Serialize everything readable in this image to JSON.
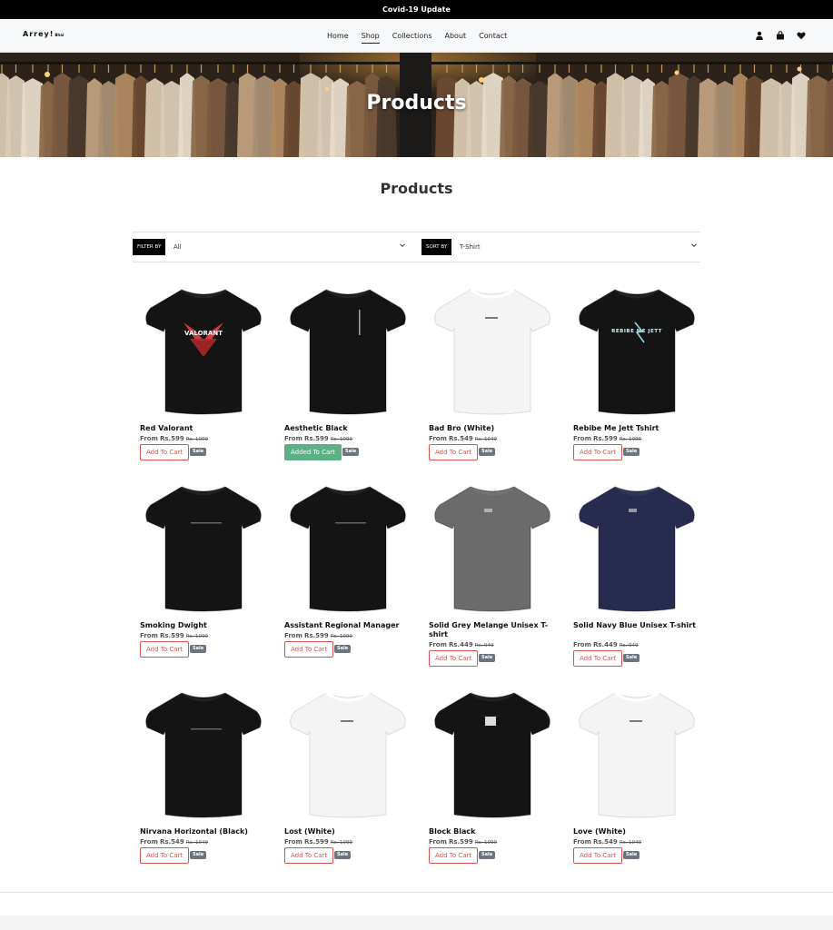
{
  "banner": {
    "text": "Covid-19 Update"
  },
  "brand": {
    "name": "Arrey!",
    "suffix": "Bhai"
  },
  "nav": {
    "items": [
      "Home",
      "Shop",
      "Collections",
      "About",
      "Contact"
    ],
    "active": "Shop"
  },
  "hero": {
    "title": "Products"
  },
  "section": {
    "title": "Products"
  },
  "filter": {
    "label": "FILTER BY",
    "value": "All"
  },
  "sort": {
    "label": "SORT BY",
    "value": "T-Shirt"
  },
  "products": [
    {
      "name": "Red Valorant",
      "from": "From",
      "price": "Rs.599",
      "old": "Rs. 1099",
      "button": "Add To Cart",
      "badge": "Sale",
      "shirt": "black",
      "print": "VALORANT"
    },
    {
      "name": "Aesthetic Black",
      "from": "From",
      "price": "Rs.599",
      "old": "Rs. 1099",
      "button": "Added To Cart",
      "badge": "Sale",
      "shirt": "black",
      "print": ""
    },
    {
      "name": "Bad Bro (White)",
      "from": "From",
      "price": "Rs.549",
      "old": "Rs. 1049",
      "button": "Add To Cart",
      "badge": "Sale",
      "shirt": "white",
      "print": ""
    },
    {
      "name": "Rebibe Me Jett Tshirt",
      "from": "From",
      "price": "Rs.599",
      "old": "Rs. 1099",
      "button": "Add To Cart",
      "badge": "Sale",
      "shirt": "black",
      "print": "REBIBE ME JETT"
    },
    {
      "name": "Smoking Dwight",
      "from": "From",
      "price": "Rs.599",
      "old": "Rs. 1099",
      "button": "Add To Cart",
      "badge": "Sale",
      "shirt": "black",
      "print": ""
    },
    {
      "name": "Assistant Regional Manager",
      "from": "From",
      "price": "Rs.599",
      "old": "Rs. 1099",
      "button": "Add To Cart",
      "badge": "Sale",
      "shirt": "black",
      "print": ""
    },
    {
      "name": "Solid Grey Melange Unisex T-shirt",
      "from": "From",
      "price": "Rs.449",
      "old": "Rs. 949",
      "button": "Add To Cart",
      "badge": "Sale",
      "shirt": "grey",
      "print": ""
    },
    {
      "name": "Solid Navy Blue Unisex T-shirt",
      "from": "From",
      "price": "Rs.449",
      "old": "Rs. 949",
      "button": "Add To Cart",
      "badge": "Sale",
      "shirt": "navy",
      "print": ""
    },
    {
      "name": "Nirvana Horizontal (Black)",
      "from": "From",
      "price": "Rs.549",
      "old": "Rs. 1049",
      "button": "Add To Cart",
      "badge": "Sale",
      "shirt": "black",
      "print": ""
    },
    {
      "name": "Lost (White)",
      "from": "From",
      "price": "Rs.599",
      "old": "Rs. 1099",
      "button": "Add To Cart",
      "badge": "Sale",
      "shirt": "white",
      "print": ""
    },
    {
      "name": "Block Black",
      "from": "From",
      "price": "Rs.599",
      "old": "Rs. 1099",
      "button": "Add To Cart",
      "badge": "Sale",
      "shirt": "black",
      "print": ""
    },
    {
      "name": "Love (White)",
      "from": "From",
      "price": "Rs.549",
      "old": "Rs. 1049",
      "button": "Add To Cart",
      "badge": "Sale",
      "shirt": "white",
      "print": ""
    }
  ],
  "colors": {
    "black": "#141414",
    "white": "#f4f4f4",
    "grey": "#6b6b6b",
    "navy": "#262b4f",
    "accent": "#d9534f",
    "added": "#5cb085",
    "badge": "#6c757d"
  },
  "icons": {
    "user": "user-icon",
    "bag": "shopping-bag-icon",
    "heart": "heart-icon",
    "chevron": "chevron-down-icon"
  }
}
